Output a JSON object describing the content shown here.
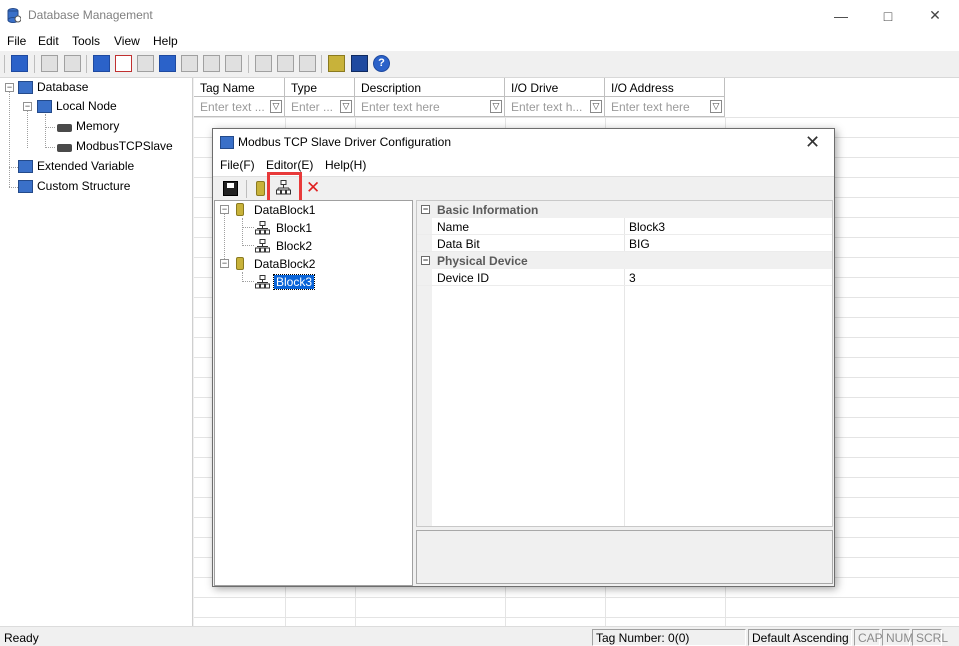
{
  "window": {
    "title": "Database Management"
  },
  "menu": [
    "File",
    "Edit",
    "Tools",
    "View",
    "Help"
  ],
  "tree": {
    "root": "Database",
    "local_node": "Local Node",
    "memory": "Memory",
    "slave": "ModbusTCPSlave",
    "extended": "Extended Variable",
    "custom": "Custom Structure"
  },
  "grid": {
    "columns": [
      {
        "label": "Tag Name",
        "filter": "Enter text ..."
      },
      {
        "label": "Type",
        "filter": "Enter ..."
      },
      {
        "label": "Description",
        "filter": "Enter text here"
      },
      {
        "label": "I/O Drive",
        "filter": "Enter text h..."
      },
      {
        "label": "I/O Address",
        "filter": "Enter text here"
      }
    ]
  },
  "status": {
    "ready": "Ready",
    "tag_number": "Tag Number: 0(0)",
    "sort": "Default Ascending",
    "cap": "CAP",
    "num": "NUM",
    "scrl": "SCRL"
  },
  "dialog": {
    "title": "Modbus TCP Slave Driver Configuration",
    "menu": [
      "File(F)",
      "Editor(E)",
      "Help(H)"
    ],
    "tree": {
      "db1": "DataBlock1",
      "block1": "Block1",
      "block2": "Block2",
      "db2": "DataBlock2",
      "block3": "Block3"
    },
    "props": {
      "cat1": "Basic Information",
      "name_key": "Name",
      "name_val": "Block3",
      "databit_key": "Data Bit",
      "databit_val": "BIG",
      "cat2": "Physical Device",
      "device_key": "Device ID",
      "device_val": "3"
    }
  },
  "colors": {
    "highlight": "#e83a3a",
    "selection": "#0a64d8"
  }
}
